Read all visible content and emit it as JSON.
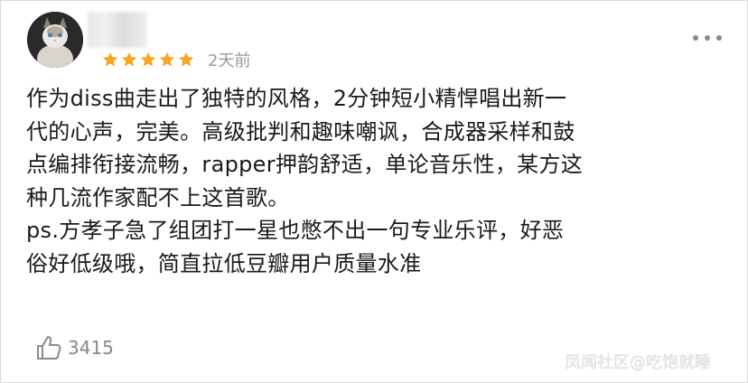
{
  "review": {
    "time": "2天前",
    "rating": 5,
    "star_color": "#f5a623",
    "content_lines": [
      "作为diss曲走出了独特的风格，2分钟短小精悍唱出新一",
      "代的心声，完美。高级批判和趣味嘲讽，合成器采样和鼓",
      "点编排衔接流畅，rapper押韵舒适，单论音乐性，某方这",
      "种几流作家配不上这首歌。",
      "ps.方孝子急了组团打一星也憋不出一句专业乐评，好恶",
      "俗好低级哦，简直拉低豆瓣用户质量水准"
    ],
    "like_count": "3415"
  },
  "icons": {
    "avatar": "cat-avatar",
    "more": "more-dots-icon",
    "like": "thumbs-up-icon",
    "star": "star-icon"
  },
  "watermark": "凤闻社区@吃饱就睡"
}
